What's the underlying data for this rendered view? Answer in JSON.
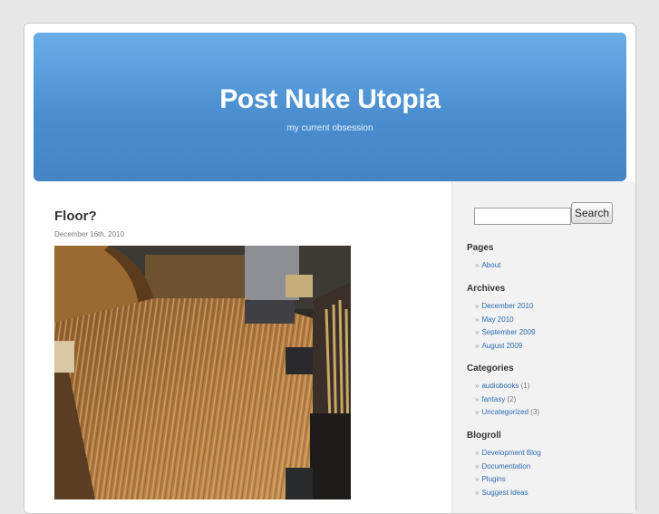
{
  "header": {
    "title": "Post Nuke Utopia",
    "description": "my current obsession"
  },
  "post": {
    "title": "Floor?",
    "date": "December 16th, 2010"
  },
  "search": {
    "button_label": "Search",
    "placeholder": ""
  },
  "sidebar": {
    "pages": {
      "heading": "Pages",
      "items": [
        {
          "label": "About"
        }
      ]
    },
    "archives": {
      "heading": "Archives",
      "items": [
        {
          "label": "December 2010"
        },
        {
          "label": "May 2010"
        },
        {
          "label": "September 2009"
        },
        {
          "label": "August 2009"
        }
      ]
    },
    "categories": {
      "heading": "Categories",
      "items": [
        {
          "label": "audiobooks",
          "count": "(1)"
        },
        {
          "label": "fantasy",
          "count": "(2)"
        },
        {
          "label": "Uncategorized",
          "count": "(3)"
        }
      ]
    },
    "blogroll": {
      "heading": "Blogroll",
      "items": [
        {
          "label": "Development Blog"
        },
        {
          "label": "Documentation"
        },
        {
          "label": "Plugins"
        },
        {
          "label": "Suggest Ideas"
        }
      ]
    }
  },
  "bullet": "»",
  "colors": {
    "header_top": "#69aee7",
    "header_bottom": "#4483c6",
    "link": "#2a6bb3",
    "background": "#e7e7e7"
  }
}
